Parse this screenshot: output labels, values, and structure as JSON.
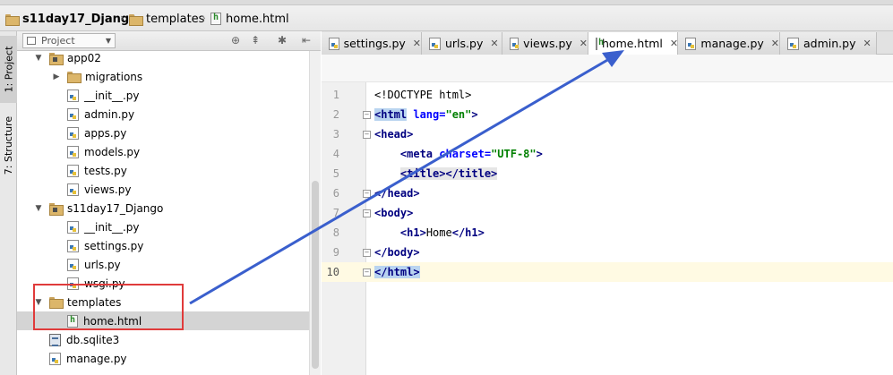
{
  "breadcrumb": {
    "items": [
      {
        "label": "s11day17_Django",
        "icon": "folder-icon"
      },
      {
        "label": "templates",
        "icon": "folder-icon"
      },
      {
        "label": "home.html",
        "icon": "html-file-icon"
      }
    ]
  },
  "toolstrip": {
    "project_tab": "1: Project",
    "structure_tab": "7: Structure"
  },
  "project_panel": {
    "selector_label": "Project",
    "tree": [
      {
        "label": "app02",
        "type": "module",
        "expanded": true,
        "depth": 1
      },
      {
        "label": "migrations",
        "type": "folder",
        "expanded": false,
        "depth": 2
      },
      {
        "label": "__init__.py",
        "type": "py",
        "depth": 2
      },
      {
        "label": "admin.py",
        "type": "py",
        "depth": 2
      },
      {
        "label": "apps.py",
        "type": "py",
        "depth": 2
      },
      {
        "label": "models.py",
        "type": "py",
        "depth": 2
      },
      {
        "label": "tests.py",
        "type": "py",
        "depth": 2
      },
      {
        "label": "views.py",
        "type": "py",
        "depth": 2
      },
      {
        "label": "s11day17_Django",
        "type": "module",
        "expanded": true,
        "depth": 1
      },
      {
        "label": "__init__.py",
        "type": "py",
        "depth": 2
      },
      {
        "label": "settings.py",
        "type": "py",
        "depth": 2
      },
      {
        "label": "urls.py",
        "type": "py",
        "depth": 2
      },
      {
        "label": "wsgi.py",
        "type": "py",
        "depth": 2
      },
      {
        "label": "templates",
        "type": "folder",
        "expanded": true,
        "depth": 1
      },
      {
        "label": "home.html",
        "type": "html",
        "depth": 2,
        "selected": true
      },
      {
        "label": "db.sqlite3",
        "type": "db",
        "depth": 1
      },
      {
        "label": "manage.py",
        "type": "py",
        "depth": 1
      }
    ]
  },
  "editor": {
    "tabs": [
      {
        "label": "settings.py",
        "active": false
      },
      {
        "label": "urls.py",
        "active": false
      },
      {
        "label": "views.py",
        "active": false
      },
      {
        "label": "home.html",
        "active": true
      },
      {
        "label": "manage.py",
        "active": false
      },
      {
        "label": "admin.py",
        "active": false
      }
    ],
    "line_numbers": [
      "1",
      "2",
      "3",
      "4",
      "5",
      "6",
      "7",
      "8",
      "9",
      "10"
    ],
    "code": {
      "l1": "<!DOCTYPE html>",
      "l2_tag": "<html",
      "l2_attr": " lang=",
      "l2_val": "\"en\"",
      "l2_end": ">",
      "l3": "<head>",
      "l4_tag": "<meta",
      "l4_attr": " charset=",
      "l4_val": "\"UTF-8\"",
      "l4_end": ">",
      "l5_open": "<title>",
      "l5_close": "</title>",
      "l6": "</head>",
      "l7": "<body>",
      "l8_open": "<h1>",
      "l8_text": "Home",
      "l8_close": "</h1>",
      "l9": "</body>",
      "l10": "</html>"
    }
  },
  "colors": {
    "annotation_box": "#e03b3b",
    "annotation_arrow": "#3a5fcd",
    "selection": "#d4d4d4",
    "current_line": "#fffae3"
  }
}
